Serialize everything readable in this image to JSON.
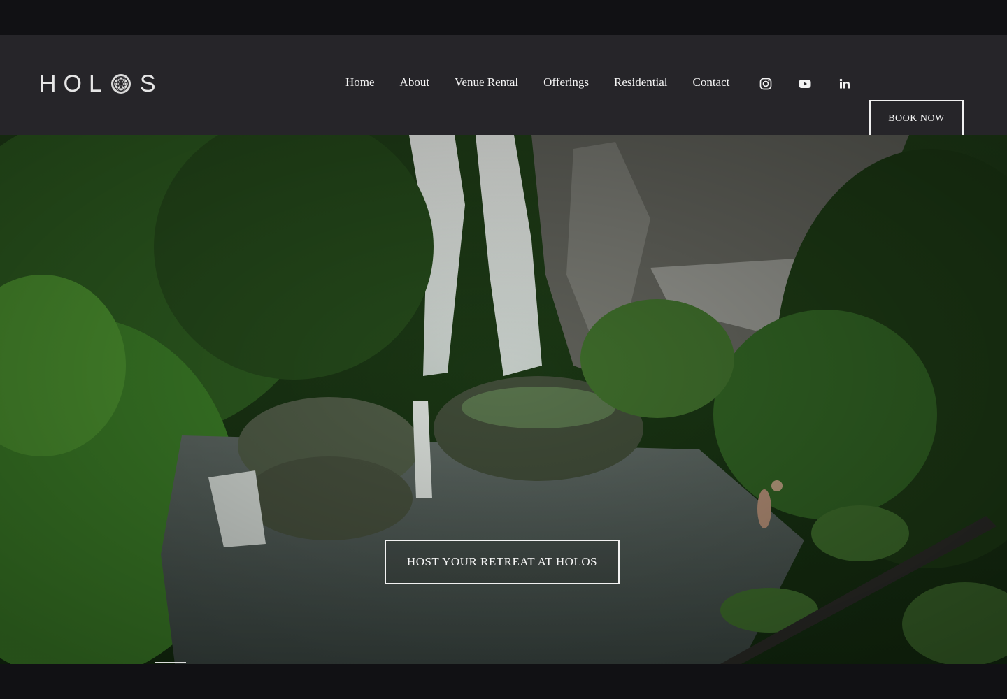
{
  "brand": {
    "logo_left": "HOL",
    "logo_right": "S",
    "mark_icon": "flower-of-life-icon"
  },
  "nav": {
    "items": [
      {
        "label": "Home",
        "active": true
      },
      {
        "label": "About",
        "active": false
      },
      {
        "label": "Venue Rental",
        "active": false
      },
      {
        "label": "Offerings",
        "active": false
      },
      {
        "label": "Residential",
        "active": false
      },
      {
        "label": "Contact",
        "active": false
      }
    ],
    "social": [
      "instagram-icon",
      "youtube-icon",
      "linkedin-icon"
    ],
    "book_label": "BOOK NOW"
  },
  "hero": {
    "cta_label": "HOST YOUR RETREAT AT HOLOS",
    "background": "waterfall-jungle-photo"
  },
  "colors": {
    "header_bg": "#262529",
    "page_bg": "#111114",
    "text": "#f4f4f4"
  }
}
